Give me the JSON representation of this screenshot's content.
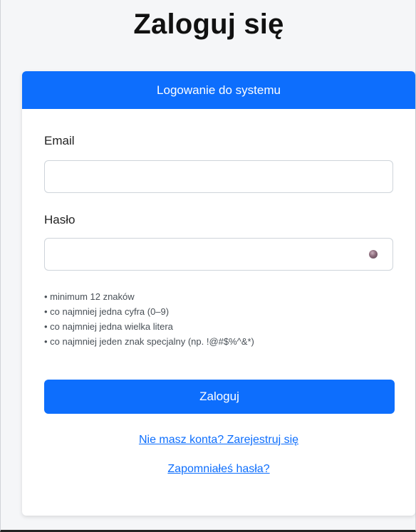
{
  "page": {
    "title": "Zaloguj się"
  },
  "card": {
    "header": "Logowanie do systemu",
    "email_label": "Email",
    "email_value": "",
    "email_placeholder": "",
    "password_label": "Hasło",
    "password_value": "",
    "password_placeholder": "",
    "password_toggle_icon": "eye-icon",
    "rules": [
      "minimum 12 znaków",
      "co najmniej jedna cyfra (0–9)",
      "co najmniej jedna wielka litera",
      "co najmniej jeden znak specjalny (np. !@#$%^&*)"
    ],
    "submit_label": "Zaloguj",
    "register_link": "Nie masz konta? Zarejestruj się",
    "forgot_link": "Zapomniałeś hasła?"
  },
  "colors": {
    "primary": "#0d6efd",
    "background": "#f5f6f8"
  }
}
